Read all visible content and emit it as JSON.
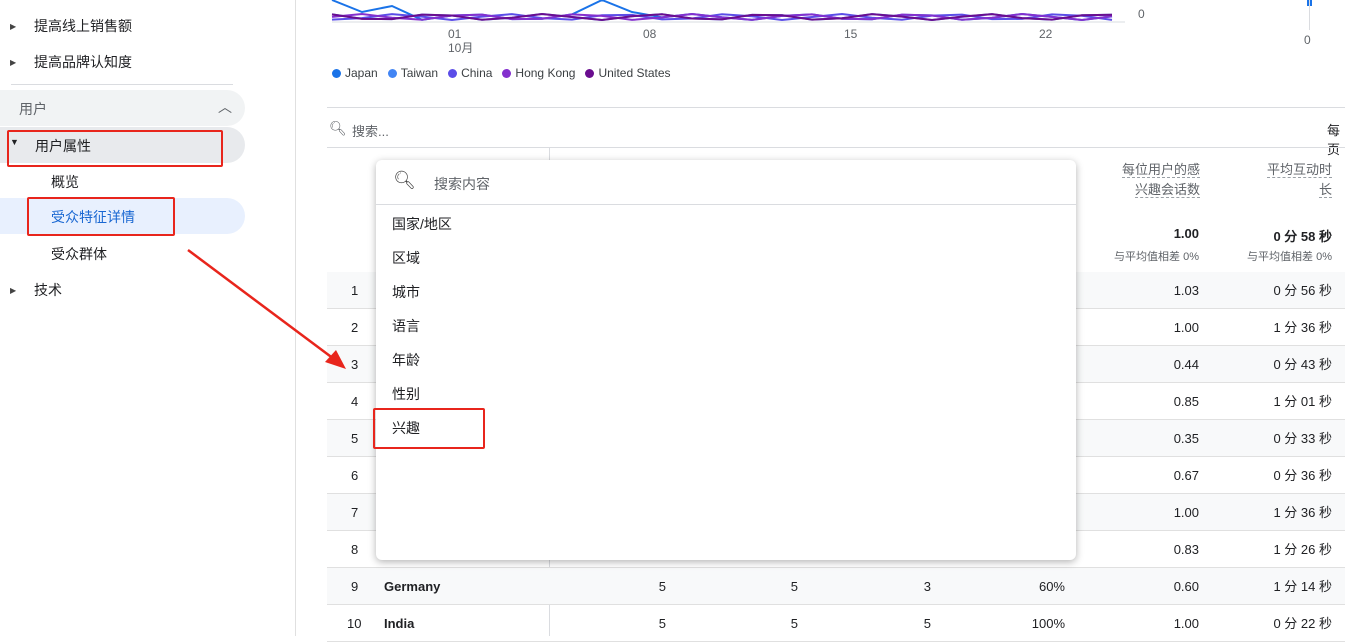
{
  "sidebar": {
    "items": [
      {
        "label": "提高线上销售额"
      },
      {
        "label": "提高品牌认知度"
      }
    ],
    "section": {
      "label": "用户"
    },
    "group": {
      "label": "用户属性",
      "children": [
        {
          "label": "概览"
        },
        {
          "label": "受众特征详情",
          "active": true
        },
        {
          "label": "受众群体"
        }
      ]
    },
    "tech": {
      "label": "技术"
    }
  },
  "chart_data": {
    "type": "line",
    "x_ticks": [
      "01",
      "08",
      "15",
      "22"
    ],
    "x_month": "10月",
    "y_tick": "0",
    "mini_y_tick": "0",
    "legend": [
      {
        "name": "Japan",
        "color": "#1a73e8"
      },
      {
        "name": "Taiwan",
        "color": "#4285f4"
      },
      {
        "name": "China",
        "color": "#5b4de8"
      },
      {
        "name": "Hong Kong",
        "color": "#8430ce"
      },
      {
        "name": "United States",
        "color": "#6a0d8f"
      }
    ]
  },
  "table": {
    "search_placeholder": "搜索...",
    "per_page_label": "每页",
    "col_headers": [
      {
        "line1": "每位用户的感",
        "line2": "兴趣会话数"
      },
      {
        "line1": "平均互动时",
        "line2": "长"
      }
    ],
    "totals": [
      {
        "value": "1.00",
        "note": "与平均值相差 0%"
      },
      {
        "value": "0 分 58 秒",
        "note": "与平均值相差 0%"
      }
    ],
    "rows": [
      {
        "n": "1",
        "cols": [
          "",
          "",
          "",
          "",
          "1.03",
          "0 分 56 秒"
        ]
      },
      {
        "n": "2",
        "cols": [
          "",
          "",
          "",
          "",
          "1.00",
          "1 分 36 秒"
        ]
      },
      {
        "n": "3",
        "cols": [
          "",
          "",
          "",
          "",
          "0.44",
          "0 分 43 秒"
        ]
      },
      {
        "n": "4",
        "cols": [
          "",
          "",
          "",
          "",
          "0.85",
          "1 分 01 秒"
        ]
      },
      {
        "n": "5",
        "cols": [
          "",
          "",
          "",
          "",
          "0.35",
          "0 分 33 秒"
        ]
      },
      {
        "n": "6",
        "cols": [
          "",
          "",
          "",
          "",
          "0.67",
          "0 分 36 秒"
        ]
      },
      {
        "n": "7",
        "cols": [
          "",
          "",
          "",
          "",
          "1.00",
          "1 分 36 秒"
        ]
      },
      {
        "n": "8",
        "cols": [
          "",
          "",
          "",
          "",
          "0.83",
          "1 分 26 秒"
        ]
      },
      {
        "n": "9",
        "name": "Germany",
        "cols": [
          "5",
          "5",
          "3",
          "60%",
          "0.60",
          "1 分 14 秒"
        ]
      },
      {
        "n": "10",
        "name": "India",
        "cols": [
          "5",
          "5",
          "5",
          "100%",
          "1.00",
          "0 分 22 秒"
        ]
      }
    ]
  },
  "dropdown": {
    "search_placeholder": "搜索内容",
    "options": [
      "国家/地区",
      "区域",
      "城市",
      "语言",
      "年龄",
      "性别",
      "兴趣"
    ]
  }
}
